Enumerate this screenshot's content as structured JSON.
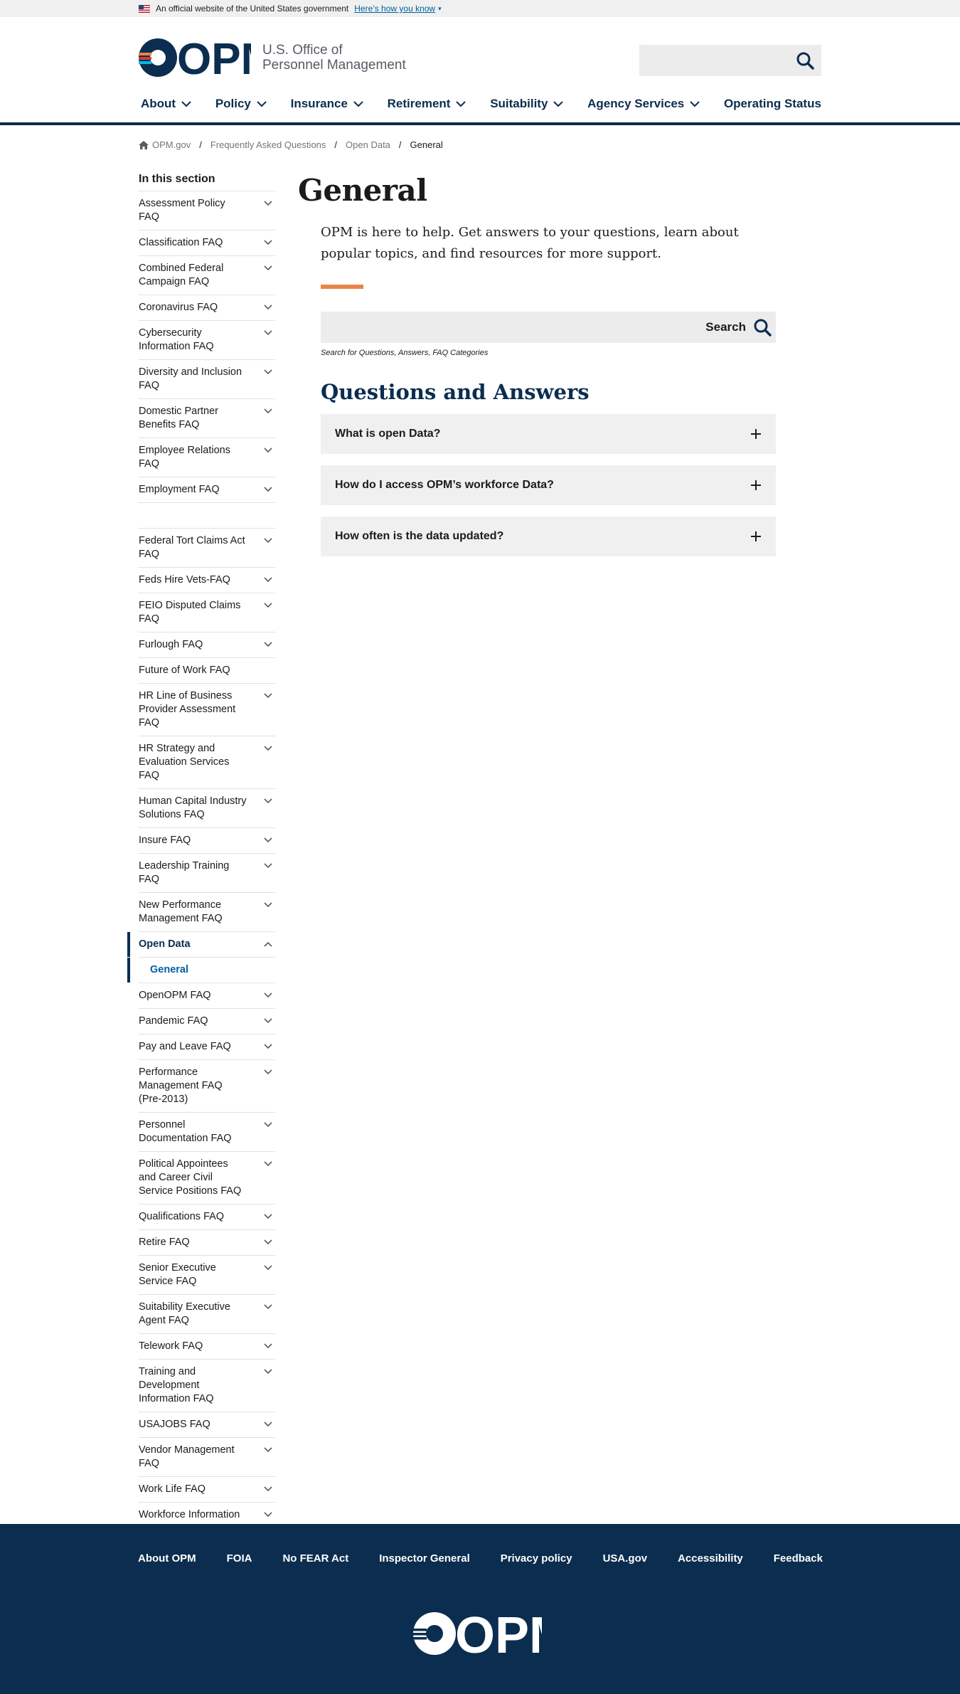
{
  "banner": {
    "text": "An official website of the United States government",
    "link": "Here’s how you know"
  },
  "logo": {
    "mark": "OPM",
    "line1": "U.S. Office of",
    "line2": "Personnel Management"
  },
  "nav": [
    "About",
    "Policy",
    "Insurance",
    "Retirement",
    "Suitability",
    "Agency Services",
    "Operating Status"
  ],
  "breadcrumb": [
    "OPM.gov",
    "Frequently Asked Questions",
    "Open Data",
    "General"
  ],
  "sidebar": {
    "heading": "In this section",
    "items": [
      "Assessment Policy FAQ",
      "Classification FAQ",
      "Combined Federal Campaign FAQ",
      "Coronavirus FAQ",
      "Cybersecurity Information FAQ",
      "Diversity and Inclusion FAQ",
      "Domestic Partner Benefits FAQ",
      "Employee Relations FAQ",
      "Employment FAQ",
      "",
      "Federal Tort Claims Act FAQ",
      "Feds Hire Vets-FAQ",
      "FEIO Disputed Claims FAQ",
      "Furlough FAQ",
      "Future of Work FAQ",
      "HR Line of Business Provider Assessment FAQ",
      "HR Strategy and Evaluation Services FAQ",
      "Human Capital Industry Solutions FAQ",
      "Insure FAQ",
      "Leadership Training FAQ",
      "New Performance Management FAQ",
      "Open Data",
      "General",
      "OpenOPM FAQ",
      "Pandemic FAQ",
      "Pay and Leave FAQ",
      "Performance Management FAQ (Pre-2013)",
      "Personnel Documentation FAQ",
      "Political Appointees and Career Civil Service Positions FAQ",
      "Qualifications FAQ",
      "Retire FAQ",
      "Senior Executive Service FAQ",
      "Suitability Executive Agent FAQ",
      "Telework FAQ",
      "Training and Development Information FAQ",
      "USAJOBS FAQ",
      "Vendor Management FAQ",
      "Work Life FAQ",
      "Workforce Information FAQ"
    ]
  },
  "main": {
    "title": "General",
    "intro": "OPM is here to help. Get answers to your questions, learn about popular topics, and find resources for more support.",
    "search_button": "Search",
    "search_help": "Search for Questions, Answers, FAQ Categories",
    "qa_heading": "Questions and Answers",
    "questions": [
      "What is open Data?",
      "How do I access OPM’s workforce Data?",
      "How often is the data updated?"
    ]
  },
  "footer": {
    "links": [
      "About OPM",
      "FOIA",
      "No FEAR Act",
      "Inspector General",
      "Privacy policy",
      "USA.gov",
      "Accessibility",
      "Feedback"
    ],
    "logo": "OPM"
  },
  "colors": {
    "navy": "#0b2d4f",
    "accent": "#e8864a",
    "link": "#005ea2"
  }
}
